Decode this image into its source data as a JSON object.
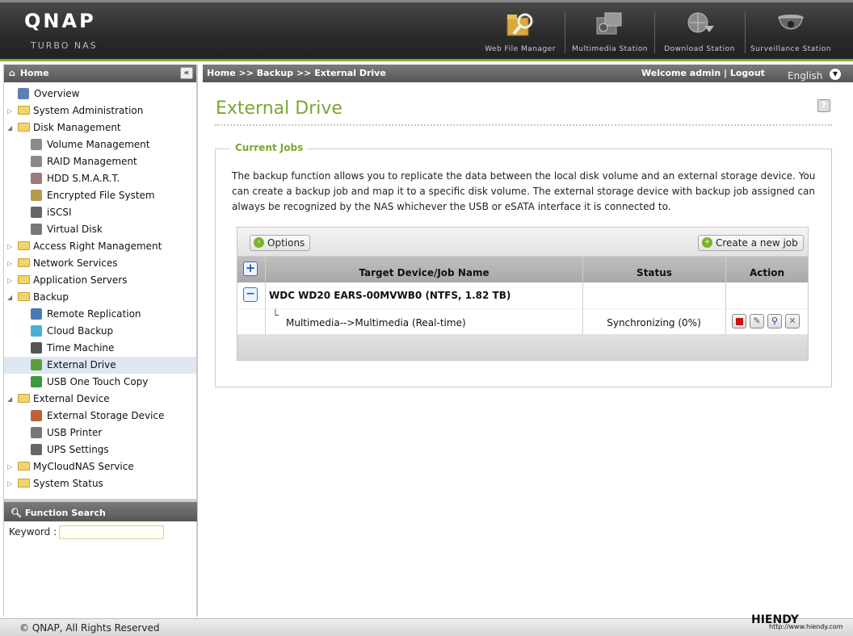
{
  "header": {
    "logo": "QNAP",
    "logo_sub": "TURBO NAS",
    "apps": [
      {
        "label": "Web File Manager",
        "icon": "folder-magnifier-icon"
      },
      {
        "label": "Multimedia Station",
        "icon": "film-camera-icon"
      },
      {
        "label": "Download Station",
        "icon": "globe-download-icon"
      },
      {
        "label": "Surveillance Station",
        "icon": "dome-camera-icon"
      }
    ]
  },
  "sidebar": {
    "title": "Home",
    "collapse_glyph": "«",
    "items": [
      {
        "label": "Overview",
        "level": 1,
        "type": "page",
        "icon": "overview-icon",
        "color": "#5c7fb5"
      },
      {
        "label": "System Administration",
        "level": 1,
        "type": "folder",
        "expanded": false
      },
      {
        "label": "Disk Management",
        "level": 1,
        "type": "folder",
        "expanded": true
      },
      {
        "label": "Volume Management",
        "level": 2,
        "type": "page",
        "icon": "volume-icon",
        "color": "#8a8a8a"
      },
      {
        "label": "RAID Management",
        "level": 2,
        "type": "page",
        "icon": "raid-icon",
        "color": "#8a8a8a"
      },
      {
        "label": "HDD S.M.A.R.T.",
        "level": 2,
        "type": "page",
        "icon": "hdd-smart-icon",
        "color": "#9a7a7a"
      },
      {
        "label": "Encrypted File System",
        "level": 2,
        "type": "page",
        "icon": "lock-icon",
        "color": "#b59a4a"
      },
      {
        "label": "iSCSI",
        "level": 2,
        "type": "page",
        "icon": "iscsi-icon",
        "color": "#666"
      },
      {
        "label": "Virtual Disk",
        "level": 2,
        "type": "page",
        "icon": "virtual-disk-icon",
        "color": "#777"
      },
      {
        "label": "Access Right Management",
        "level": 1,
        "type": "folder",
        "expanded": false
      },
      {
        "label": "Network Services",
        "level": 1,
        "type": "folder",
        "expanded": false
      },
      {
        "label": "Application Servers",
        "level": 1,
        "type": "folder",
        "expanded": false
      },
      {
        "label": "Backup",
        "level": 1,
        "type": "folder",
        "expanded": true
      },
      {
        "label": "Remote Replication",
        "level": 2,
        "type": "page",
        "icon": "remote-replication-icon",
        "color": "#4a7ab5"
      },
      {
        "label": "Cloud Backup",
        "level": 2,
        "type": "page",
        "icon": "cloud-icon",
        "color": "#4ab0d8"
      },
      {
        "label": "Time Machine",
        "level": 2,
        "type": "page",
        "icon": "apple-icon",
        "color": "#555"
      },
      {
        "label": "External Drive",
        "level": 2,
        "type": "page",
        "icon": "usb-drive-icon",
        "color": "#5aa03a",
        "selected": true
      },
      {
        "label": "USB One Touch Copy",
        "level": 2,
        "type": "page",
        "icon": "usb-icon",
        "color": "#3a9a3a"
      },
      {
        "label": "External Device",
        "level": 1,
        "type": "folder",
        "expanded": true
      },
      {
        "label": "External Storage Device",
        "level": 2,
        "type": "page",
        "icon": "external-storage-icon",
        "color": "#c0603a"
      },
      {
        "label": "USB Printer",
        "level": 2,
        "type": "page",
        "icon": "printer-icon",
        "color": "#777"
      },
      {
        "label": "UPS Settings",
        "level": 2,
        "type": "page",
        "icon": "ups-icon",
        "color": "#666"
      },
      {
        "label": "MyCloudNAS Service",
        "level": 1,
        "type": "folder",
        "expanded": false
      },
      {
        "label": "System Status",
        "level": 1,
        "type": "folder",
        "expanded": false
      }
    ]
  },
  "function_search": {
    "title": "Function Search",
    "keyword_label": "Keyword :",
    "keyword_value": ""
  },
  "breadcrumb": {
    "text": "Home >> Backup >> External Drive",
    "welcome": "Welcome admin | Logout",
    "language": "English"
  },
  "page": {
    "title": "External Drive",
    "help_glyph": "?",
    "panel_title": "Current Jobs",
    "description": "The backup function allows you to replicate the data between the local disk volume and an external storage device. You can create a backup job and map it to a specific disk volume. The external storage device with backup job assigned can always be recognized by the NAS whichever the USB or eSATA interface it is connected to."
  },
  "jobs": {
    "options_label": "Options",
    "create_label": "Create a new job",
    "columns": [
      "Target Device/Job Name",
      "Status",
      "Action"
    ],
    "device": "WDC WD20 EARS-00MVWB0 (NTFS, 1.82 TB)",
    "job_name": "Multimedia-->Multimedia (Real-time)",
    "job_status": "Synchronizing (0%)",
    "actions": [
      {
        "name": "stop",
        "icon": "stop-icon",
        "color": "#d01010"
      },
      {
        "name": "edit",
        "icon": "edit-icon",
        "color": "#2a6a2a"
      },
      {
        "name": "view",
        "icon": "magnifier-icon",
        "color": "#1a3a8a"
      },
      {
        "name": "delete",
        "icon": "delete-icon",
        "color": "#666"
      }
    ]
  },
  "footer": {
    "copyright": "© QNAP, All Rights Reserved",
    "watermark": "HIENDY",
    "watermark_url": "http://www.hiendy.com"
  }
}
